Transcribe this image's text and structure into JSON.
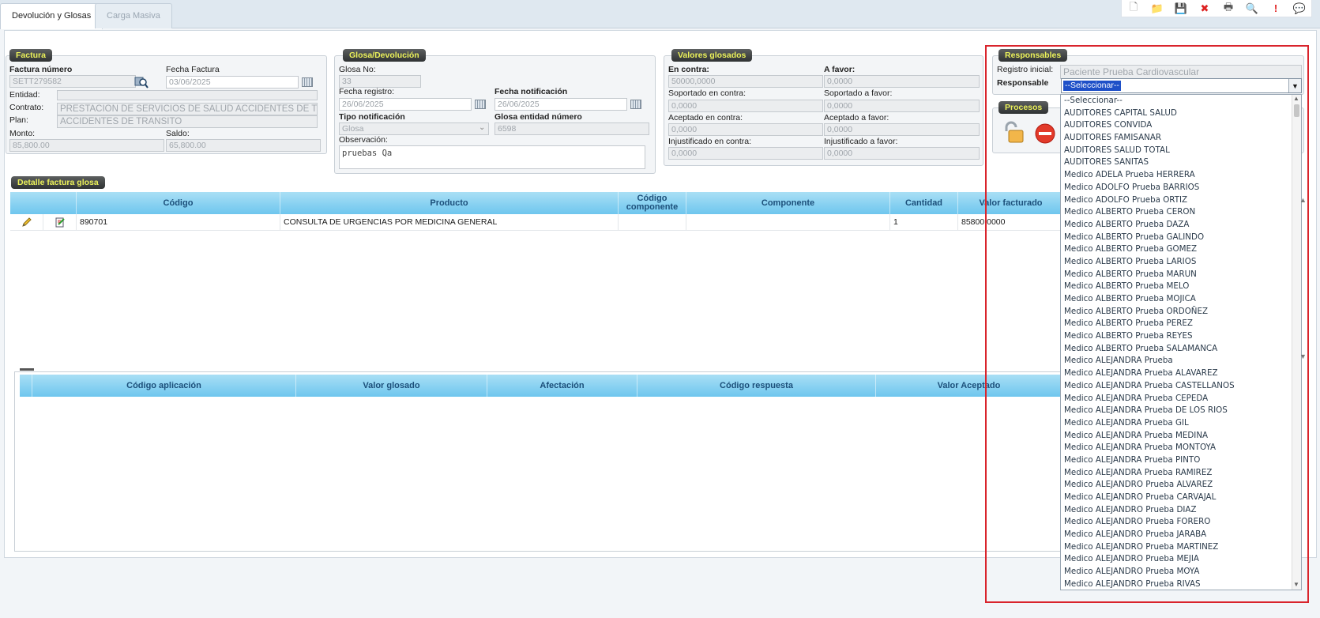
{
  "tabs": [
    {
      "label": "Devolución y Glosas",
      "active": true
    },
    {
      "label": "Carga Masiva",
      "active": false
    }
  ],
  "toolbar_icons": [
    "new-doc-icon",
    "folder-icon",
    "save-icon",
    "delete-icon",
    "print-icon",
    "preview-icon",
    "alert-icon",
    "comment-icon"
  ],
  "toolbar_glyphs": [
    "🗋",
    "📁",
    "💾",
    "✖",
    "🖶",
    "🔍",
    "!",
    "💬"
  ],
  "factura": {
    "legend": "Factura",
    "numero_label": "Factura número",
    "numero_value": "SETT279582",
    "fecha_label": "Fecha Factura",
    "fecha_value": "03/06/2025",
    "entidad_label": "Entidad:",
    "contrato_label": "Contrato:",
    "contrato_value": "PRESTACION DE SERVICIOS DE SALUD ACCIDENTES DE T",
    "plan_label": "Plan:",
    "plan_value": "ACCIDENTES DE TRANSITO",
    "monto_label": "Monto:",
    "monto_value": "85,800.00",
    "saldo_label": "Saldo:",
    "saldo_value": "65,800.00"
  },
  "glosa": {
    "legend": "Glosa/Devolución",
    "no_label": "Glosa No:",
    "no_value": "33",
    "fecha_registro_label": "Fecha registro:",
    "fecha_registro_value": "26/06/2025",
    "fecha_notif_label": "Fecha notificación",
    "fecha_notif_value": "26/06/2025",
    "tipo_label": "Tipo notificación",
    "tipo_value": "Glosa",
    "entidad_num_label": "Glosa entidad número",
    "entidad_num_value": "6598",
    "obs_label": "Observación:",
    "obs_value": "pruebas Qa"
  },
  "valores": {
    "legend": "Valores glosados",
    "en_contra_label": "En contra:",
    "en_contra_value": "50000,0000",
    "a_favor_label": "A favor:",
    "a_favor_value": "0,0000",
    "sop_contra_label": "Soportado en contra:",
    "sop_contra_value": "0,0000",
    "sop_favor_label": "Soportado a favor:",
    "sop_favor_value": "0,0000",
    "acep_contra_label": "Aceptado en contra:",
    "acep_contra_value": "0,0000",
    "acep_favor_label": "Aceptado a favor:",
    "acep_favor_value": "0,0000",
    "inj_contra_label": "Injustificado en contra:",
    "inj_contra_value": "0,0000",
    "inj_favor_label": "Injustificado a favor:",
    "inj_favor_value": "0,0000"
  },
  "responsables": {
    "legend": "Responsables",
    "registro_label": "Registro inicial:",
    "registro_value": "Paciente Prueba Cardiovascular",
    "responsable_label": "Responsable",
    "selected": "--Seleccionar--",
    "options": [
      "--Seleccionar--",
      "AUDITORES CAPITAL SALUD",
      "AUDITORES CONVIDA",
      "AUDITORES FAMISANAR",
      "AUDITORES SALUD TOTAL",
      "AUDITORES SANITAS",
      "Medico ADELA Prueba HERRERA",
      "Medico ADOLFO Prueba BARRIOS",
      "Medico ADOLFO Prueba ORTIZ",
      "Medico ALBERTO Prueba CERON",
      "Medico ALBERTO Prueba DAZA",
      "Medico ALBERTO Prueba GALINDO",
      "Medico ALBERTO Prueba GOMEZ",
      "Medico ALBERTO Prueba LARIOS",
      "Medico ALBERTO Prueba MARUN",
      "Medico ALBERTO Prueba MELO",
      "Medico ALBERTO Prueba MOJICA",
      "Medico ALBERTO Prueba ORDOÑEZ",
      "Medico ALBERTO Prueba PEREZ",
      "Medico ALBERTO Prueba REYES",
      "Medico ALBERTO Prueba SALAMANCA",
      "Medico ALEJANDRA Prueba",
      "Medico ALEJANDRA Prueba ALAVAREZ",
      "Medico ALEJANDRA Prueba CASTELLANOS",
      "Medico ALEJANDRA Prueba CEPEDA",
      "Medico ALEJANDRA Prueba DE LOS RIOS",
      "Medico ALEJANDRA Prueba GIL",
      "Medico ALEJANDRA Prueba MEDINA",
      "Medico ALEJANDRA Prueba MONTOYA",
      "Medico ALEJANDRA Prueba PINTO",
      "Medico ALEJANDRA Prueba RAMIREZ",
      "Medico ALEJANDRO Prueba ALVAREZ",
      "Medico ALEJANDRO Prueba CARVAJAL",
      "Medico ALEJANDRO Prueba DIAZ",
      "Medico ALEJANDRO Prueba FORERO",
      "Medico ALEJANDRO Prueba JARABA",
      "Medico ALEJANDRO Prueba MARTINEZ",
      "Medico ALEJANDRO Prueba MEJIA",
      "Medico ALEJANDRO Prueba MOYA",
      "Medico ALEJANDRO Prueba RIVAS"
    ]
  },
  "procesos": {
    "legend": "Procesos"
  },
  "detalle": {
    "legend": "Detalle factura glosa",
    "headers": [
      "Código",
      "Producto",
      "Código componente",
      "Componente",
      "Cantidad",
      "Valor facturado"
    ],
    "row": {
      "codigo": "890701",
      "producto": "CONSULTA DE URGENCIAS POR MEDICINA GENERAL",
      "codigo_componente": "",
      "componente": "",
      "cantidad": "1",
      "valor": "85800,0000"
    }
  },
  "aplicacion": {
    "headers": [
      "Código aplicación",
      "Valor glosado",
      "Afectación",
      "Código respuesta",
      "Valor Aceptado"
    ]
  },
  "colors": {
    "highlight": "#d9242c",
    "legend_text": "#ecf25a",
    "grid_header": "#6ec6ee"
  }
}
